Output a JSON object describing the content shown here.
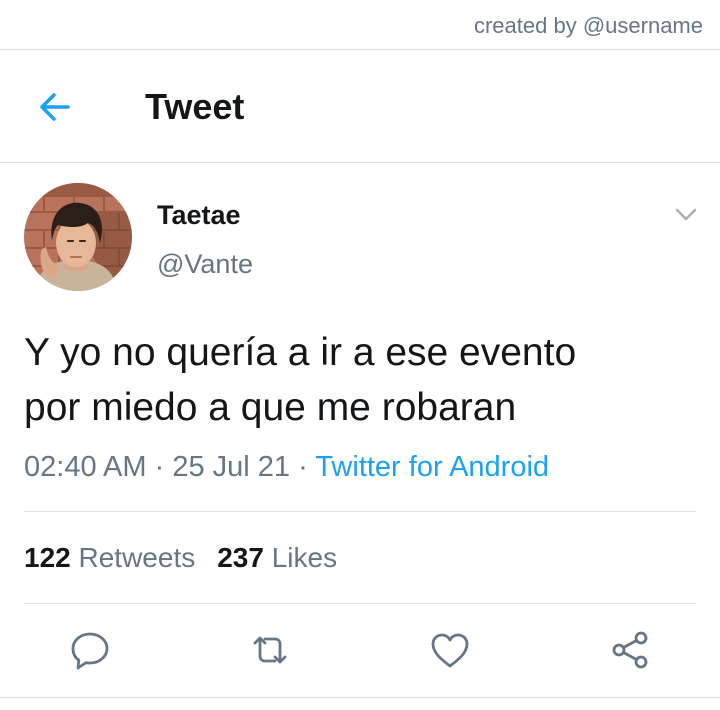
{
  "watermark": {
    "text": "created by @username"
  },
  "header": {
    "back_icon": "arrow-left-icon",
    "title": "Tweet"
  },
  "tweet": {
    "author": {
      "display_name": "Taetae",
      "handle": "@Vante"
    },
    "text_lines": [
      "Y yo no quería a ir a ese evento",
      "por miedo a que me robaran"
    ],
    "meta": {
      "time": "02:40 AM",
      "separator": "·",
      "date": "25 Jul 21",
      "source": "Twitter for Android"
    },
    "stats": {
      "retweets_count": "122",
      "retweets_label": "Retweets",
      "likes_count": "237",
      "likes_label": "Likes"
    },
    "actions": {
      "reply": "reply-icon",
      "retweet": "retweet-icon",
      "like": "heart-icon",
      "share": "share-icon"
    }
  },
  "colors": {
    "accent": "#1da1f2",
    "text_primary": "#14171a",
    "text_secondary": "#657786",
    "divider": "#dcdfe3"
  }
}
